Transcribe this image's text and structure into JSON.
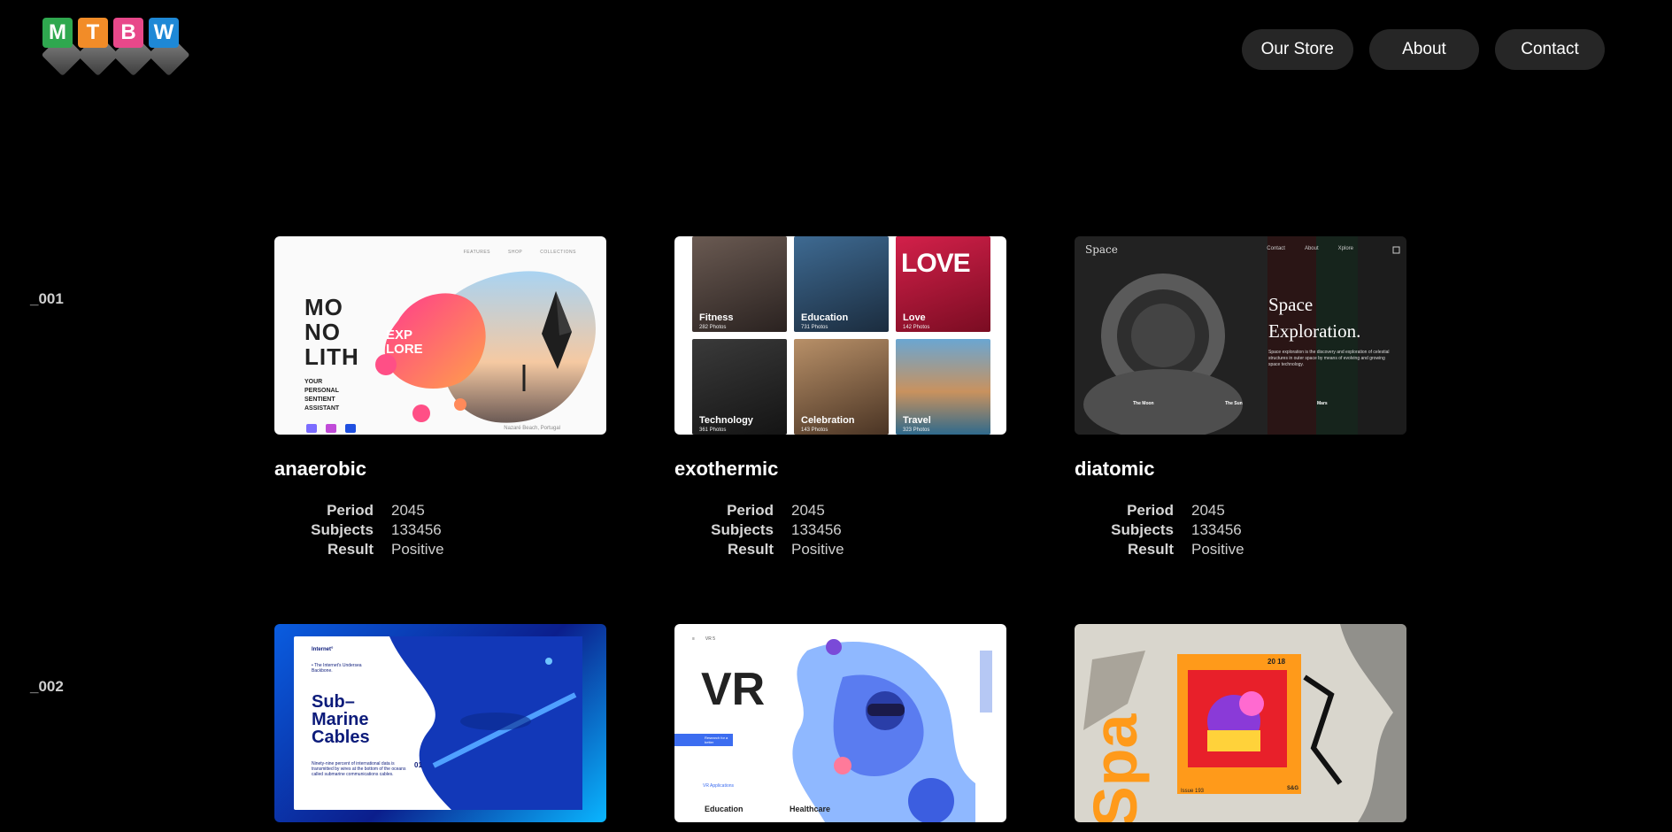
{
  "logo": {
    "letters": [
      {
        "char": "M",
        "color": "#2fa84f"
      },
      {
        "char": "T",
        "color": "#f28c28"
      },
      {
        "char": "B",
        "color": "#e8488a"
      },
      {
        "char": "W",
        "color": "#1e88d6"
      }
    ]
  },
  "nav": {
    "store": "Our Store",
    "about": "About",
    "contact": "Contact"
  },
  "rows": [
    {
      "label": "_001",
      "cards": [
        {
          "title": "anaerobic",
          "meta": {
            "period_k": "Period",
            "period_v": "2045",
            "subjects_k": "Subjects",
            "subjects_v": "133456",
            "result_k": "Result",
            "result_v": "Positive"
          },
          "thumb": {
            "nav": [
              "FEATURES",
              "SHOP",
              "COLLECTIONS"
            ],
            "title_lines": [
              "MO",
              "NO",
              "LITH"
            ],
            "badge_lines": [
              "EXP",
              "LORE"
            ],
            "sub_lines": [
              "YOUR",
              "PERSONAL",
              "SENTIENT",
              "ASSISTANT"
            ],
            "caption": "Nazaré Beach, Portugal"
          }
        },
        {
          "title": "exothermic",
          "meta": {
            "period_k": "Period",
            "period_v": "2045",
            "subjects_k": "Subjects",
            "subjects_v": "133456",
            "result_k": "Result",
            "result_v": "Positive"
          },
          "thumb": {
            "tiles": [
              {
                "label": "Fitness",
                "count": "282 Photos",
                "color": "#4a3b35"
              },
              {
                "label": "Education",
                "count": "731 Photos",
                "color": "#2e4e6e"
              },
              {
                "label": "Love",
                "count": "142 Photos",
                "color": "#a3122f"
              },
              {
                "label": "Technology",
                "count": "361 Photos",
                "color": "#2a2a2a"
              },
              {
                "label": "Celebration",
                "count": "143 Photos",
                "color": "#8a6a4a"
              },
              {
                "label": "Travel",
                "count": "323 Photos",
                "color": "#3c7aa6"
              }
            ]
          }
        },
        {
          "title": "diatomic",
          "meta": {
            "period_k": "Period",
            "period_v": "2045",
            "subjects_k": "Subjects",
            "subjects_v": "133456",
            "result_k": "Result",
            "result_v": "Positive"
          },
          "thumb": {
            "logo": "Space",
            "nav": [
              "Contact",
              "About",
              "Xplore"
            ],
            "title_lines": [
              "Space",
              "Exploration."
            ],
            "body": "Space exploration is the discovery and exploration of celestial structures in outer space by means of evolving and growing space technology.",
            "cols": [
              "The Moon",
              "The Sun",
              "Mars"
            ]
          }
        }
      ]
    },
    {
      "label": "_002",
      "cards": [
        {
          "thumb": {
            "brand": "Internet°",
            "kicker": "• The Internet's Undersea Backbone.",
            "title_lines": [
              "Sub–",
              "Marine",
              "Cables"
            ],
            "body": "Ninety-nine percent of international data is transmitted by wires at the bottom of the oceans called submarine communications cables.",
            "num": "01"
          }
        },
        {
          "thumb": {
            "nav": [
              "≡",
              "VR 5"
            ],
            "title": "VR",
            "button": "Research for a better",
            "app": "VR Applications",
            "cols": [
              "Education",
              "Healthcare"
            ]
          }
        },
        {
          "thumb": {
            "num": "20 18",
            "issue": "Issue 193",
            "brand": "S&G"
          }
        }
      ]
    }
  ]
}
